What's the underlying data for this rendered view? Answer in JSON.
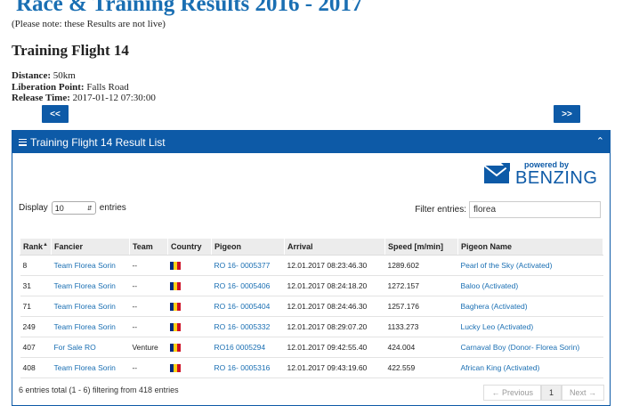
{
  "page": {
    "title": "Race & Training Results 2016 - 2017",
    "note": "(Please note: these Results are not live)"
  },
  "flight": {
    "title": "Training Flight 14",
    "distance_label": "Distance:",
    "distance": "50km",
    "liberation_label": "Liberation Point:",
    "liberation": "Falls Road",
    "release_label": "Release Time:",
    "release": "2017-01-12 07:30:00"
  },
  "nav": {
    "prev": "<<",
    "next": ">>"
  },
  "panel": {
    "title": "Training Flight 14 Result List",
    "brand_small": "powered by",
    "brand_name": "BENZING"
  },
  "controls": {
    "display_label": "Display",
    "display_value": "10",
    "entries_label": "entries",
    "filter_label": "Filter entries:",
    "filter_value": "florea"
  },
  "table": {
    "headers": [
      "Rank",
      "Fancier",
      "Team",
      "Country",
      "Pigeon",
      "Arrival",
      "Speed [m/min]",
      "Pigeon Name"
    ],
    "rows": [
      {
        "rank": "8",
        "fancier": "Team Florea Sorin",
        "team": "--",
        "pigeon": "RO 16- 0005377",
        "arrival": "12.01.2017 08:23:46.30",
        "speed": "1289.602",
        "name": "Pearl of the Sky (Activated)"
      },
      {
        "rank": "31",
        "fancier": "Team Florea Sorin",
        "team": "--",
        "pigeon": "RO 16- 0005406",
        "arrival": "12.01.2017 08:24:18.20",
        "speed": "1272.157",
        "name": "Baloo (Activated)"
      },
      {
        "rank": "71",
        "fancier": "Team Florea Sorin",
        "team": "--",
        "pigeon": "RO 16- 0005404",
        "arrival": "12.01.2017 08:24:46.30",
        "speed": "1257.176",
        "name": "Baghera (Activated)"
      },
      {
        "rank": "249",
        "fancier": "Team Florea Sorin",
        "team": "--",
        "pigeon": "RO 16- 0005332",
        "arrival": "12.01.2017 08:29:07.20",
        "speed": "1133.273",
        "name": "Lucky Leo (Activated)"
      },
      {
        "rank": "407",
        "fancier": "For Sale RO",
        "team": "Venture",
        "pigeon": "RO16 0005294",
        "arrival": "12.01.2017 09:42:55.40",
        "speed": "424.004",
        "name": "Carnaval Boy (Donor- Florea Sorin)"
      },
      {
        "rank": "408",
        "fancier": "Team Florea Sorin",
        "team": "--",
        "pigeon": "RO 16- 0005316",
        "arrival": "12.01.2017 09:43:19.60",
        "speed": "422.559",
        "name": "African King (Activated)"
      }
    ],
    "flag_colors": [
      "#002b7f",
      "#fcd116",
      "#ce1126"
    ]
  },
  "footer": {
    "info": "6 entries total (1 - 6) filtering from 418 entries",
    "prev": "← Previous",
    "page": "1",
    "next": "Next →"
  },
  "colors": {
    "accent": "#0d5aa7",
    "link": "#1a6fb3"
  }
}
